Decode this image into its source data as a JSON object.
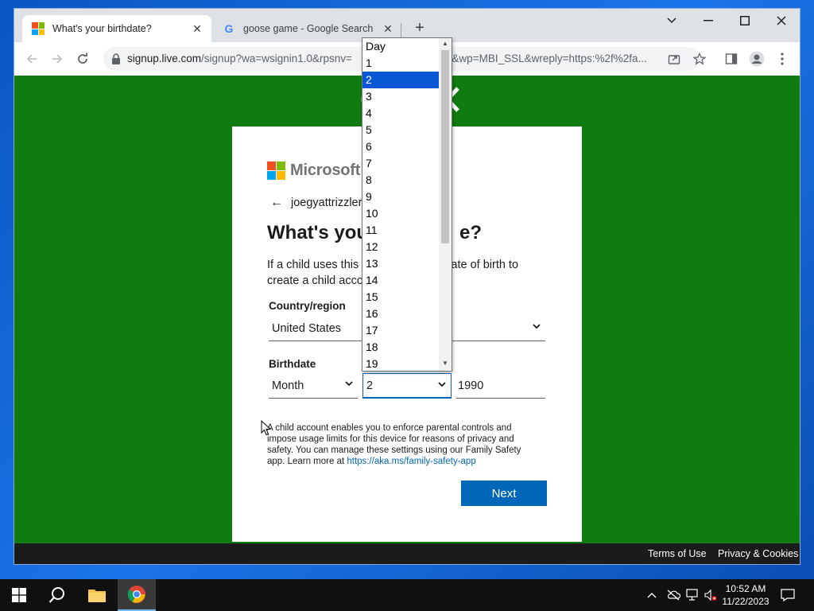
{
  "browser": {
    "tabs": [
      {
        "title": "What's your birthdate?",
        "active": true
      },
      {
        "title": "goose game - Google Search",
        "active": false
      }
    ],
    "url_main": "signup.live.com",
    "url_rest": "/signup?wa=wsignin1.0&rpsnv=",
    "url_tail": "0&wp=MBI_SSL&wreply=https:%2f%2fa..."
  },
  "page": {
    "brand_name": "Microsoft",
    "identity": "joegyattrizzler",
    "heading_start": "What's you",
    "heading_end": "e?",
    "desc_line1_start": "If a child uses this",
    "desc_line1_end": "ir date of birth to",
    "desc_line2": "create a child acco",
    "country_label": "Country/region",
    "country_value": "United States",
    "birthdate_label": "Birthdate",
    "month_value": "Month",
    "day_value": "2",
    "year_value": "1990",
    "note_text": "A child account enables you to enforce parental controls and impose usage limits for this device for reasons of privacy and safety. You can manage these settings using our Family Safety app. Learn more at ",
    "note_link": "https://aka.ms/family-safety-app",
    "next_label": "Next",
    "footer_terms": "Terms of Use",
    "footer_privacy": "Privacy & Cookies"
  },
  "day_dropdown": {
    "options": [
      "Day",
      "1",
      "2",
      "3",
      "4",
      "5",
      "6",
      "7",
      "8",
      "9",
      "10",
      "11",
      "12",
      "13",
      "14",
      "15",
      "16",
      "17",
      "18",
      "19"
    ],
    "selected": "2"
  },
  "taskbar": {
    "time": "10:52 AM",
    "date": "11/22/2023"
  },
  "colors": {
    "page_green": "#107c10",
    "accent_blue": "#0067b8",
    "dropdown_selected": "#0a57d6"
  }
}
